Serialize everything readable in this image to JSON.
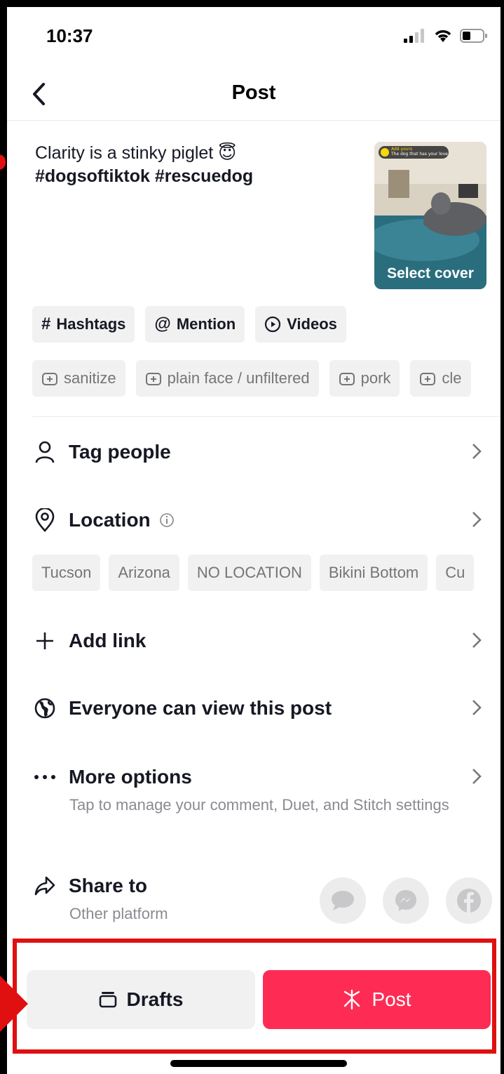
{
  "status_bar": {
    "time": "10:37"
  },
  "header": {
    "title": "Post"
  },
  "caption": {
    "text": "Clarity is a stinky piglet 😇",
    "hashtags": "#dogsoftiktok #rescuedog"
  },
  "cover": {
    "label": "Select cover",
    "badge_line1": "Add yours",
    "badge_line2": "The dog that has your love"
  },
  "tools": [
    {
      "icon": "#",
      "label": "Hashtags"
    },
    {
      "icon": "@",
      "label": "Mention"
    },
    {
      "icon": "▶",
      "label": "Videos"
    }
  ],
  "suggested_tags": [
    "sanitize",
    "plain face / unfiltered",
    "pork",
    "cle"
  ],
  "rows": {
    "tag_people": "Tag people",
    "location": "Location",
    "add_link": "Add link",
    "privacy": "Everyone can view this post",
    "more_options": "More options",
    "more_options_sub": "Tap to manage your comment, Duet, and Stitch settings",
    "share_to": "Share to",
    "share_to_sub": "Other platform"
  },
  "location_suggestions": [
    "Tucson",
    "Arizona",
    "NO LOCATION",
    "Bikini Bottom",
    "Cu"
  ],
  "share_targets": [
    "message-icon",
    "messenger-icon",
    "facebook-icon"
  ],
  "buttons": {
    "drafts": "Drafts",
    "post": "Post"
  },
  "colors": {
    "post_button": "#fe2c55",
    "drafts_button": "#f1f1f2",
    "annotation": "#e01010"
  }
}
